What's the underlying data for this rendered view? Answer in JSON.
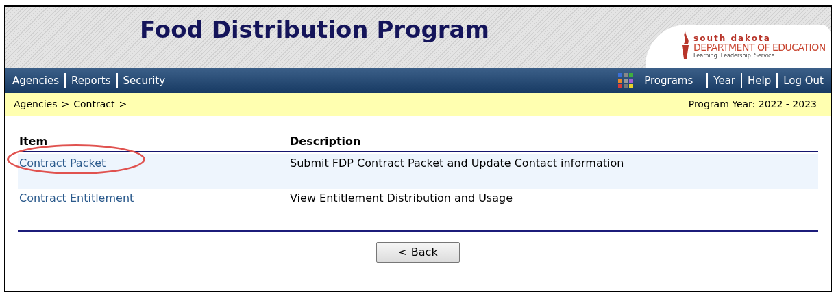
{
  "header": {
    "title": "Food Distribution Program",
    "logo": {
      "line_1": "south dakota",
      "line_2": "DEPARTMENT OF EDUCATION",
      "tagline": "Learning. Leadership. Service."
    }
  },
  "nav": {
    "left": [
      "Agencies",
      "Reports",
      "Security"
    ],
    "right": [
      "Programs",
      "Year",
      "Help",
      "Log Out"
    ]
  },
  "breadcrumb": [
    "Agencies",
    "Contract"
  ],
  "breadcrumb_separator": ">",
  "program_year": "Program Year: 2022 - 2023",
  "table": {
    "columns": [
      "Item",
      "Description"
    ],
    "rows": [
      {
        "item": "Contract Packet",
        "description": "Submit FDP Contract Packet and Update Contact information",
        "circled": true
      },
      {
        "item": "Contract Entitlement",
        "description": "View Entitlement Distribution and Usage",
        "circled": false
      }
    ]
  },
  "back_button": "< Back"
}
